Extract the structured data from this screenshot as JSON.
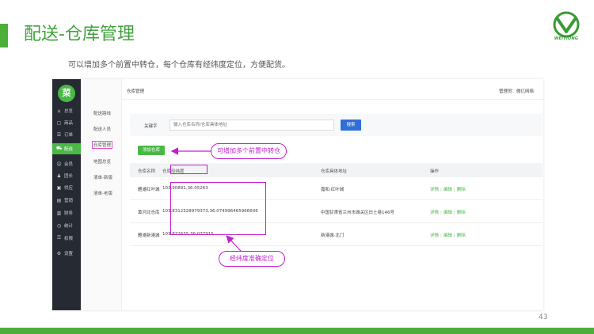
{
  "slide": {
    "title": "配送-仓库管理",
    "subtitle": "可以增加多个前置中转仓，每个仓库有经纬度定位，方便配货。",
    "page_number": "43",
    "logo_text": "WEIYIONG",
    "accent_color": "#4caf3a"
  },
  "app": {
    "logo_char": "菜",
    "nav": [
      {
        "label": "总览",
        "icon": "home-icon",
        "glyph": "⌂"
      },
      {
        "label": "商品",
        "icon": "box-icon",
        "glyph": "▢"
      },
      {
        "label": "订单",
        "icon": "order-icon",
        "glyph": "☰"
      },
      {
        "label": "配送",
        "icon": "truck-icon",
        "glyph": "⛟"
      },
      {
        "label": "会员",
        "icon": "member-icon",
        "glyph": "☺"
      },
      {
        "label": "团长",
        "icon": "leader-icon",
        "glyph": "♟"
      },
      {
        "label": "供应",
        "icon": "supply-icon",
        "glyph": "▣"
      },
      {
        "label": "营销",
        "icon": "marketing-icon",
        "glyph": "▤"
      },
      {
        "label": "财务",
        "icon": "finance-icon",
        "glyph": "▥"
      },
      {
        "label": "统计",
        "icon": "stats-icon",
        "glyph": "◷"
      },
      {
        "label": "权限",
        "icon": "permission-icon",
        "glyph": "⚿"
      },
      {
        "label": "设置",
        "icon": "settings-icon",
        "glyph": "⚙"
      }
    ],
    "sub_nav": [
      "配送路线",
      "配送人员",
      "仓库管理",
      "地图总览",
      "清单-新版",
      "清单-老版"
    ],
    "header": {
      "breadcrumb": "仓库管理",
      "admin": "管理员：微亿网络"
    },
    "search": {
      "label": "关键字",
      "placeholder": "输入仓库名称/仓库具体地址",
      "button": "搜索"
    },
    "add_button": "添加仓库",
    "table": {
      "headers": [
        "仓库名称",
        "仓库经纬度",
        "仓库具体地址",
        "操作"
      ],
      "rows": [
        {
          "name": "雁滩红叶城",
          "coords": "103.90891,36.05263",
          "address": "嘉和·红叶城"
        },
        {
          "name": "黄河北仓库",
          "coords": "103.8312328979373,36.074996465966606",
          "address": "中国甘肃省兰州市城关区白土巷146号"
        },
        {
          "name": "雁滩新港城",
          "coords": "103.872635,36.077915",
          "address": "新港城·北门"
        }
      ],
      "actions": [
        "详情",
        "编辑",
        "删除"
      ],
      "separator": "|"
    }
  },
  "annotations": {
    "callout_top": "可增加多个前置中转仓",
    "callout_bottom": "经纬度准确定位",
    "color": "#c21fd0"
  }
}
